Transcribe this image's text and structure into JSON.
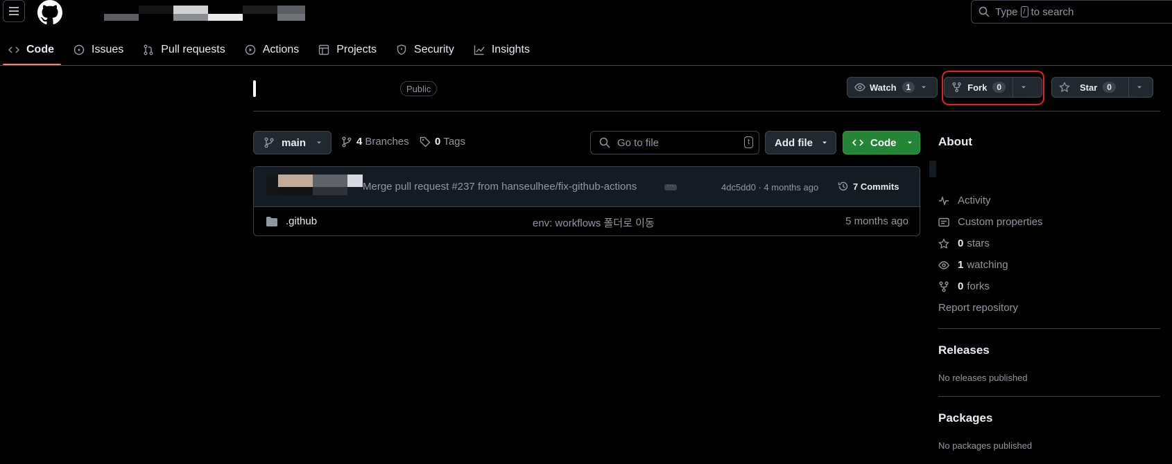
{
  "header": {
    "search_prefix": "Type",
    "search_key": "/",
    "search_suffix": "to search"
  },
  "tabs": [
    {
      "label": "Code",
      "icon": "code-icon",
      "active": true
    },
    {
      "label": "Issues",
      "icon": "issue-opened-icon"
    },
    {
      "label": "Pull requests",
      "icon": "git-pull-request-icon"
    },
    {
      "label": "Actions",
      "icon": "play-icon"
    },
    {
      "label": "Projects",
      "icon": "table-icon"
    },
    {
      "label": "Security",
      "icon": "shield-icon"
    },
    {
      "label": "Insights",
      "icon": "graph-icon"
    }
  ],
  "repo": {
    "visibility": "Public",
    "watch_label": "Watch",
    "watch_count": "1",
    "fork_label": "Fork",
    "fork_count": "0",
    "star_label": "Star",
    "star_count": "0"
  },
  "filenav": {
    "branch": "main",
    "branches_count": "4",
    "branches_label": "Branches",
    "tags_count": "0",
    "tags_label": "Tags",
    "goto_placeholder": "Go to file",
    "goto_key": "t",
    "add_file": "Add file",
    "code": "Code"
  },
  "commit": {
    "message": "Merge pull request #237 from hanseulhee/fix-github-actions",
    "meta": "4dc5dd0 · 4 months ago",
    "commits_label": "7 Commits"
  },
  "files": [
    {
      "name": ".github",
      "message": "env: workflows 폴더로 이동",
      "date": "5 months ago"
    }
  ],
  "about": {
    "title": "About",
    "activity": "Activity",
    "custom_properties": "Custom properties",
    "stars_count": "0",
    "stars_label": "stars",
    "watching_count": "1",
    "watching_label": "watching",
    "forks_count": "0",
    "forks_label": "forks",
    "report": "Report repository"
  },
  "releases": {
    "title": "Releases",
    "note": "No releases published"
  },
  "packages": {
    "title": "Packages",
    "note": "No packages published"
  },
  "colors": {
    "accent_green": "#238636",
    "tab_underline": "#f78166",
    "highlight": "#e5231b"
  }
}
